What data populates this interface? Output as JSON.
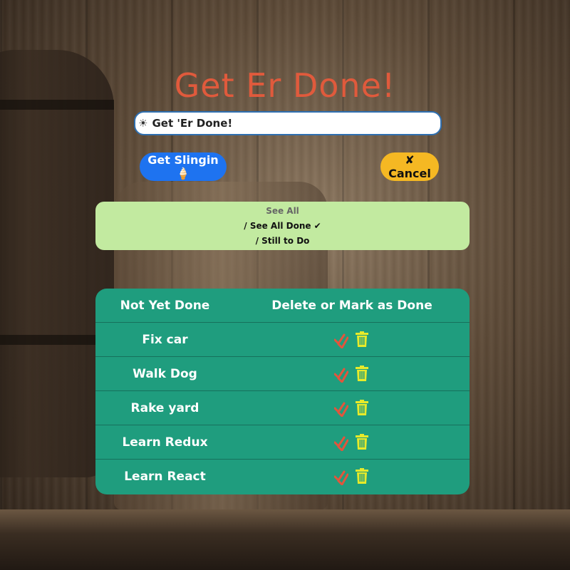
{
  "app": {
    "title": "Get Er Done!",
    "input": {
      "icon": "sun-icon",
      "glyph": "☀",
      "value": "",
      "placeholder": "Get 'Er Done!"
    },
    "buttons": {
      "submit": "Get Slingin 🍦",
      "cancel": "✘ Cancel"
    },
    "filters": {
      "all": "See All",
      "done": "/ See All Done ✔",
      "todo": "/ Still to Do"
    },
    "table": {
      "headers": [
        "Not Yet Done",
        "Delete or Mark as Done"
      ],
      "rows": [
        {
          "task": "Fix car"
        },
        {
          "task": "Walk Dog"
        },
        {
          "task": "Rake yard"
        },
        {
          "task": "Learn Redux"
        },
        {
          "task": "Learn React"
        }
      ],
      "icons": {
        "done": "double-check-icon",
        "delete": "trash-icon"
      }
    },
    "colors": {
      "title": "#e05a3c",
      "submit_bg": "#1e73f0",
      "cancel_bg": "#f5b823",
      "filters_bg": "#c2eaa0",
      "table_bg": "#1f9d7e",
      "check": "#e2553c",
      "trash": "#e7ea2a"
    }
  }
}
